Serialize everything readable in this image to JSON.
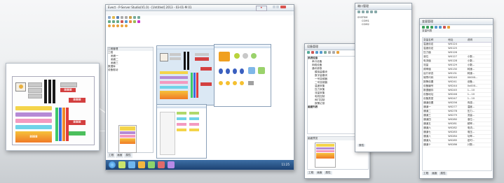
{
  "main_window": {
    "title": "Evect - P-Server Studio(V1.0) - [Untitled] 2013 - 03-01-M 01",
    "tray_badge": "•",
    "tree_header": "工程管理",
    "tree_items": [
      "工程",
      "画面一",
      "画面二",
      "画面三",
      "数据库",
      "设备驱动"
    ],
    "status_tabs": [
      "工程",
      "画面",
      "属性"
    ],
    "taskbar_time": "11:25"
  },
  "panel_digits": [
    "8888",
    "8888",
    "8888",
    "8888"
  ],
  "tree_window": {
    "title": "设备管理",
    "root": "系统设备",
    "items": [
      "串口设备",
      "网络设备",
      "通讯参数",
      "模拟量模块",
      "数字量模块",
      "一号变频器",
      "二号变频器",
      "温度采集",
      "压力采集",
      "流量采集",
      "电机控制",
      "阀门控制",
      "报警记录"
    ],
    "sub_root": "画面列表",
    "preview_title": "画面预览",
    "tab_labels": [
      "工程",
      "画面",
      "属性"
    ]
  },
  "ports_window": {
    "title": "端口管理",
    "root": "SYSTEM",
    "ports": [
      "COM1",
      "COM2"
    ],
    "footer": "属性"
  },
  "var_window": {
    "title": "变量管理",
    "subtitle": "变量列表",
    "columns": [
      "变量名称",
      "地址",
      "说明"
    ],
    "rows": [
      [
        "温度设定",
        "W0124",
        ""
      ],
      [
        "温度设定",
        "W0125",
        ""
      ],
      [
        "压力值",
        "W0126",
        ""
      ],
      [
        "液位",
        "W0127",
        "小数..."
      ],
      [
        "电流值",
        "W0128",
        "小数..."
      ],
      [
        "流量",
        "W0129",
        "小数..."
      ],
      [
        "频率值",
        "W0130",
        "转速..."
      ],
      [
        "运行状态",
        "W0131",
        "转速..."
      ],
      [
        "故障代码",
        "W0240",
        "00000..."
      ],
      [
        "报警设置",
        "W0241",
        "设备..."
      ],
      [
        "设备编号",
        "W0244",
        "0x000..."
      ],
      [
        "数据缓存",
        "W0245",
        "1...10"
      ],
      [
        "设备地址",
        "W0246",
        "1...10"
      ],
      [
        "设备类型",
        "W0247",
        "1...10"
      ],
      [
        "通道设置",
        "W0256",
        "传感..."
      ],
      [
        "通道一",
        "W0277",
        "温度..."
      ],
      [
        "通道二",
        "W0278",
        "压力..."
      ],
      [
        "通道三",
        "W0279",
        "流量..."
      ],
      [
        "通道四",
        "W0280",
        "液位..."
      ],
      [
        "通道五",
        "W0281",
        "频率..."
      ],
      [
        "通道六",
        "W0282",
        "电流..."
      ],
      [
        "通道七",
        "W0283",
        "电压..."
      ],
      [
        "通道八",
        "W0284",
        "功率..."
      ],
      [
        "通道九",
        "W0285",
        "定时..."
      ],
      [
        "通道十",
        "W0286",
        "计数..."
      ]
    ],
    "footer_tabs": [
      "工程",
      "画面",
      "属性"
    ]
  }
}
